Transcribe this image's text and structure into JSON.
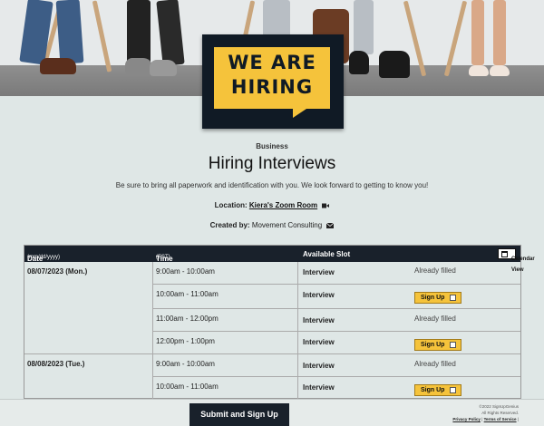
{
  "banner": {
    "line1": "WE ARE",
    "line2": "HIRING"
  },
  "event": {
    "category": "Business",
    "title": "Hiring Interviews",
    "description": "Be sure to bring all paperwork and identification with you. We look forward to getting to know you!",
    "location_label": "Location:",
    "location_value": "Kiera's Zoom Room",
    "created_label": "Created by:",
    "created_value": "Movement Consulting"
  },
  "table": {
    "col_date": "Date",
    "col_date_sub": "(mm/dd/yyyy)",
    "col_time": "Time",
    "col_time_sub": "(EST)",
    "col_slot": "Available Slot",
    "calendar_button": "Calendar View",
    "rows": [
      {
        "date": "08/07/2023 (Mon.)",
        "time": "9:00am - 10:00am",
        "slot": "Interview",
        "status": "Already filled"
      },
      {
        "date": "",
        "time": "10:00am - 11:00am",
        "slot": "Interview",
        "status": "Sign Up"
      },
      {
        "date": "",
        "time": "11:00am - 12:00pm",
        "slot": "Interview",
        "status": "Already filled"
      },
      {
        "date": "",
        "time": "12:00pm - 1:00pm",
        "slot": "Interview",
        "status": "Sign Up"
      },
      {
        "date": "08/08/2023 (Tue.)",
        "time": "9:00am - 10:00am",
        "slot": "Interview",
        "status": "Already filled"
      },
      {
        "date": "",
        "time": "10:00am - 11:00am",
        "slot": "Interview",
        "status": "Sign Up"
      }
    ]
  },
  "footer": {
    "submit": "Submit and Sign Up",
    "copyright": "©2022 SignUpGenius",
    "rights": "All Rights Reserved.",
    "privacy": "Privacy Policy",
    "sep": "|",
    "terms": "Terms of Service",
    "sep2": "|"
  },
  "colors": {
    "accent": "#f5c33b",
    "dark": "#19212b",
    "background": "#dfe7e6"
  }
}
